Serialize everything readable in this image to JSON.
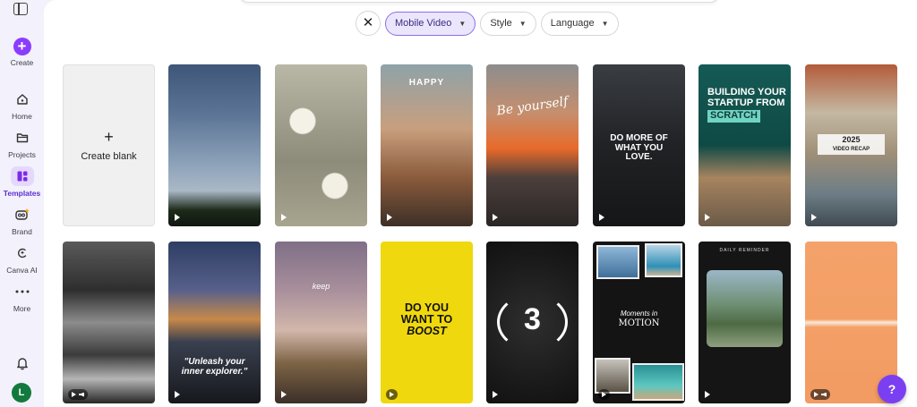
{
  "sidebar": {
    "create": "Create",
    "items": [
      {
        "label": "Home",
        "icon": "home-icon"
      },
      {
        "label": "Projects",
        "icon": "folder-icon"
      },
      {
        "label": "Templates",
        "icon": "templates-icon",
        "active": true
      },
      {
        "label": "Brand",
        "icon": "brand-icon"
      },
      {
        "label": "Canva AI",
        "icon": "canva-ai-icon"
      },
      {
        "label": "More",
        "icon": "more-dots-icon"
      }
    ],
    "avatar_initial": "L"
  },
  "filters": {
    "chips": [
      "Mobile Video",
      "Style",
      "Language"
    ]
  },
  "create_blank": "Create blank",
  "templates": [
    {
      "text": [
        "HAPPY"
      ]
    },
    {
      "text": [
        "Be yourself"
      ]
    },
    {
      "text": [
        "DO MORE OF",
        "WHAT YOU",
        "LOVE."
      ]
    },
    {
      "text": [
        "BUILDING YOUR",
        "STARTUP FROM",
        "SCRATCH"
      ]
    },
    {
      "text": [
        "2025",
        "VIDEO RECAP"
      ]
    },
    {
      "text": [
        "\"Unleash your",
        "inner explorer.\""
      ]
    },
    {
      "text": [
        "keep"
      ]
    },
    {
      "text": [
        "DO YOU",
        "WANT TO",
        "BOOST"
      ]
    },
    {
      "text": [
        "3"
      ]
    },
    {
      "text": [
        "Moments in",
        "MOTION"
      ]
    },
    {
      "text": [
        "DAILY REMINDER"
      ]
    }
  ],
  "help": "?",
  "colors": {
    "accent": "#8b3dff",
    "sidebar_bg": "#f3f1fb"
  }
}
